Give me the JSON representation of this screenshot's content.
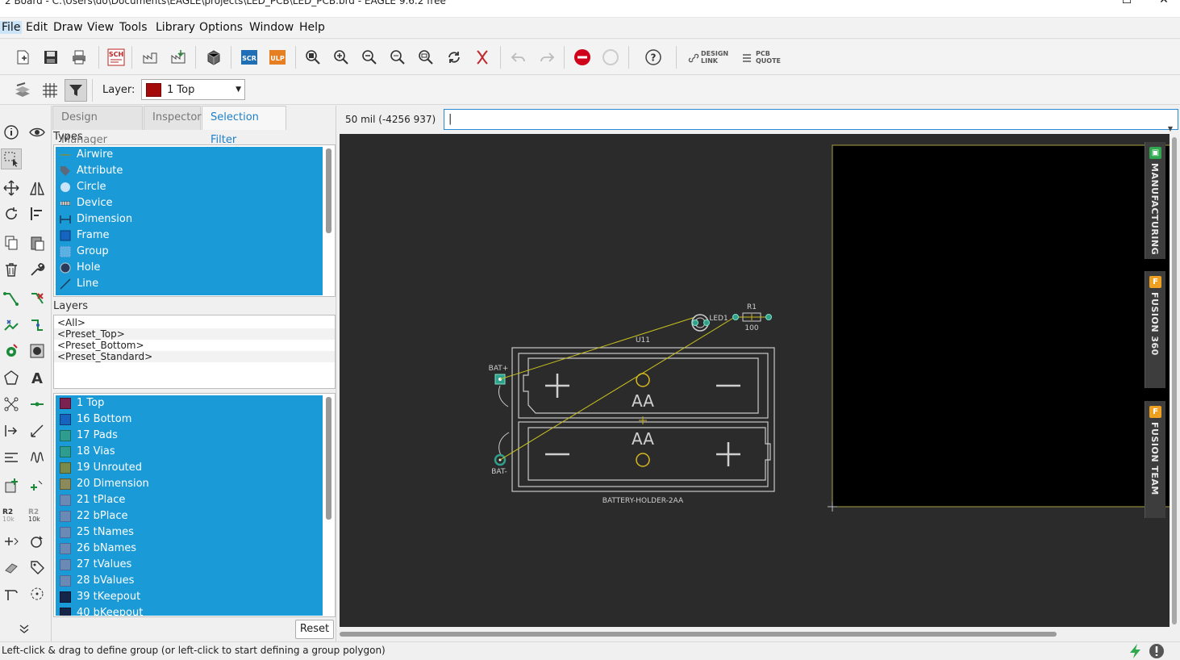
{
  "window": {
    "title": "2 Board - C:\\Users\\do\\Documents\\EAGLE\\projects\\LED_PCB\\LED_PCB.brd - EAGLE 9.6.2 free",
    "minimize": "─",
    "maximize": "☐",
    "close": "✕"
  },
  "menu": [
    "File",
    "Edit",
    "Draw",
    "View",
    "Tools",
    "Library",
    "Options",
    "Window",
    "Help"
  ],
  "toolbar": {
    "sch_label": "SCH",
    "scr_label": "SCR",
    "ulp_label": "ULP",
    "design_link": "DESIGN LINK",
    "design_link_l1": "DESIGN",
    "design_link_l2": "LINK",
    "pcb_quote_l1": "PCB",
    "pcb_quote_l2": "QUOTE",
    "help": "?"
  },
  "layerbar": {
    "label": "Layer:",
    "selected": "1 Top",
    "selected_color": "#a50a0a"
  },
  "panel": {
    "tabs": [
      "Design Manager",
      "Inspector",
      "Selection Filter"
    ],
    "active_tab": "Selection Filter",
    "types_label": "Types",
    "types": [
      {
        "name": "Airwire",
        "icon": "airwire-icon"
      },
      {
        "name": "Attribute",
        "icon": "tag-icon"
      },
      {
        "name": "Circle",
        "icon": "circle-icon"
      },
      {
        "name": "Device",
        "icon": "device-icon"
      },
      {
        "name": "Dimension",
        "icon": "dimension-icon"
      },
      {
        "name": "Frame",
        "icon": "frame-icon"
      },
      {
        "name": "Group",
        "icon": "group-icon"
      },
      {
        "name": "Hole",
        "icon": "hole-icon"
      },
      {
        "name": "Line",
        "icon": "line-icon"
      }
    ],
    "layers_label": "Layers",
    "presets": [
      "<All>",
      "<Preset_Top>",
      "<Preset_Bottom>",
      "<Preset_Standard>"
    ],
    "layers": [
      {
        "name": "1 Top",
        "color": "#7a2150"
      },
      {
        "name": "16 Bottom",
        "color": "#1565c0"
      },
      {
        "name": "17 Pads",
        "color": "#2e9d8f"
      },
      {
        "name": "18 Vias",
        "color": "#2e9d8f"
      },
      {
        "name": "19 Unrouted",
        "color": "#7a8a4a"
      },
      {
        "name": "20 Dimension",
        "color": "#8a8a5a"
      },
      {
        "name": "21 tPlace",
        "color": "#6b89b5"
      },
      {
        "name": "22 bPlace",
        "color": "#6b89b5"
      },
      {
        "name": "25 tNames",
        "color": "#6b89b5"
      },
      {
        "name": "26 bNames",
        "color": "#6b89b5"
      },
      {
        "name": "27 tValues",
        "color": "#6b89b5"
      },
      {
        "name": "28 bValues",
        "color": "#6b89b5"
      },
      {
        "name": "39 tKeepout",
        "color": "#15254a"
      },
      {
        "name": "40 bKeepout",
        "color": "#15254a"
      }
    ],
    "reset": "Reset"
  },
  "commandbar": {
    "coordinate": "50 mil (-4256 937)",
    "input_value": "|"
  },
  "board": {
    "led_label": "LED1",
    "r_label": "R1",
    "r_value": "100",
    "u_label": "U11",
    "bat_plus": "BAT+",
    "bat_minus": "BAT-",
    "aa_top": "AA",
    "aa_bottom": "AA",
    "holder_label": "BATTERY-HOLDER-2AA"
  },
  "side_tabs": [
    {
      "label": "MANUFACTURING",
      "badge": "▣",
      "badge_color": "#2fa84f"
    },
    {
      "label": "FUSION 360",
      "badge": "F",
      "badge_color": "#f0a020"
    },
    {
      "label": "FUSION TEAM",
      "badge": "F",
      "badge_color": "#f0a020"
    }
  ],
  "status": {
    "text": "Left-click & drag to define group (or left-click to start defining a group polygon)"
  }
}
